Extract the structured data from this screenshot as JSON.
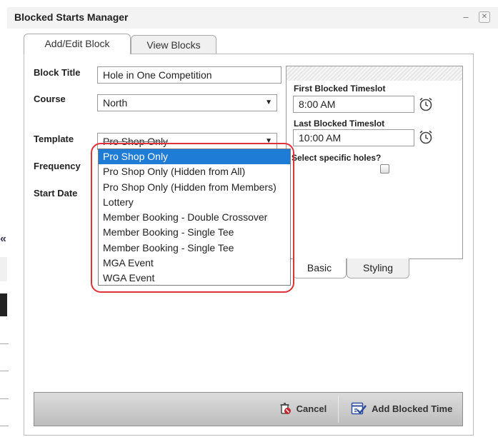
{
  "window": {
    "title": "Blocked Starts Manager",
    "minimize_glyph": "–",
    "close_glyph": "✕"
  },
  "left_page": {
    "chevron": "«"
  },
  "tabs": [
    {
      "label": "Add/Edit Block",
      "active": true
    },
    {
      "label": "View Blocks",
      "active": false
    }
  ],
  "form": {
    "block_title": {
      "label": "Block Title",
      "value": "Hole in One Competition"
    },
    "course": {
      "label": "Course",
      "value": "North"
    },
    "template": {
      "label": "Template",
      "value": "Pro Shop Only"
    },
    "frequency": {
      "label": "Frequency"
    },
    "start_date": {
      "label": "Start Date"
    }
  },
  "timeslots": {
    "first_label": "First Blocked Timeslot",
    "first_value": "8:00 AM",
    "last_label": "Last Blocked Timeslot",
    "last_value": "10:00 AM",
    "holes_label": "Select specific holes?",
    "holes_checked": false
  },
  "bottom_tabs": [
    {
      "label": "Basic",
      "active": true
    },
    {
      "label": "Styling",
      "active": false
    }
  ],
  "template_options": [
    {
      "label": "Pro Shop Only",
      "selected": true
    },
    {
      "label": "Pro Shop Only (Hidden from All)",
      "selected": false
    },
    {
      "label": "Pro Shop Only (Hidden from Members)",
      "selected": false
    },
    {
      "label": "Lottery",
      "selected": false
    },
    {
      "label": "Member Booking - Double Crossover",
      "selected": false
    },
    {
      "label": "Member Booking - Single Tee",
      "selected": false
    },
    {
      "label": "Member Booking - Single Tee",
      "selected": false
    },
    {
      "label": "MGA Event",
      "selected": false
    },
    {
      "label": "WGA Event",
      "selected": false
    }
  ],
  "footer": {
    "cancel_label": "Cancel",
    "add_label": "Add Blocked Time"
  },
  "colors": {
    "selection": "#1e7bd6",
    "highlight_ring": "#e0323a",
    "cancel_icon": "#c0282d",
    "add_icon": "#2d4f9e"
  }
}
